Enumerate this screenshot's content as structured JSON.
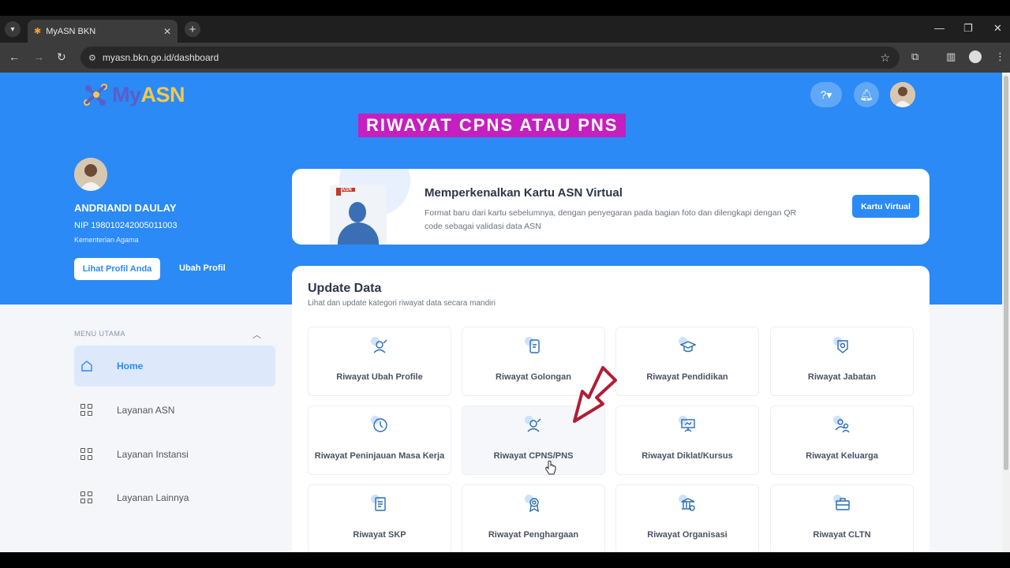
{
  "browser": {
    "tab_title": "MyASN BKN",
    "url": "myasn.bkn.go.id/dashboard"
  },
  "header": {
    "logo_prefix": "My",
    "logo_suffix": "ASN"
  },
  "overlay": {
    "banner_text": "RIWAYAT CPNS ATAU PNS"
  },
  "profile": {
    "name": "ANDRIANDI DAULAY",
    "nip": "NIP 198010242005011003",
    "institution": "Kementerian Agama",
    "view_profile_label": "Lihat Profil Anda",
    "edit_profile_label": "Ubah Profil"
  },
  "sidebar": {
    "menu_title": "MENU UTAMA",
    "items": [
      {
        "label": "Home"
      },
      {
        "label": "Layanan ASN"
      },
      {
        "label": "Layanan Instansi"
      },
      {
        "label": "Layanan Lainnya"
      }
    ]
  },
  "virtual_card": {
    "title": "Memperkenalkan Kartu ASN Virtual",
    "description": "Format baru dari kartu sebelumnya, dengan penyegaran pada bagian foto dan dilengkapi dengan QR code sebagai validasi data ASN",
    "button_label": "Kartu Virtual",
    "card_badge": "ASN"
  },
  "update_data": {
    "title": "Update Data",
    "subtitle": "Lihat dan update kategori riwayat data secara mandiri",
    "tiles": [
      {
        "label": "Riwayat Ubah Profile",
        "icon": "user-edit-icon"
      },
      {
        "label": "Riwayat Golongan",
        "icon": "phone-card-icon"
      },
      {
        "label": "Riwayat Pendidikan",
        "icon": "graduation-cap-icon"
      },
      {
        "label": "Riwayat Jabatan",
        "icon": "badge-icon"
      },
      {
        "label": "Riwayat Peninjauan Masa Kerja",
        "icon": "clock-icon"
      },
      {
        "label": "Riwayat CPNS/PNS",
        "icon": "user-edit-icon"
      },
      {
        "label": "Riwayat Diklat/Kursus",
        "icon": "presentation-icon"
      },
      {
        "label": "Riwayat Keluarga",
        "icon": "family-icon"
      },
      {
        "label": "Riwayat SKP",
        "icon": "document-icon"
      },
      {
        "label": "Riwayat Penghargaan",
        "icon": "award-icon"
      },
      {
        "label": "Riwayat Organisasi",
        "icon": "organization-icon"
      },
      {
        "label": "Riwayat CLTN",
        "icon": "briefcase-icon"
      }
    ]
  },
  "colors": {
    "primary": "#2b8af5",
    "banner": "#c51fbf",
    "arrow": "#b01e35"
  }
}
